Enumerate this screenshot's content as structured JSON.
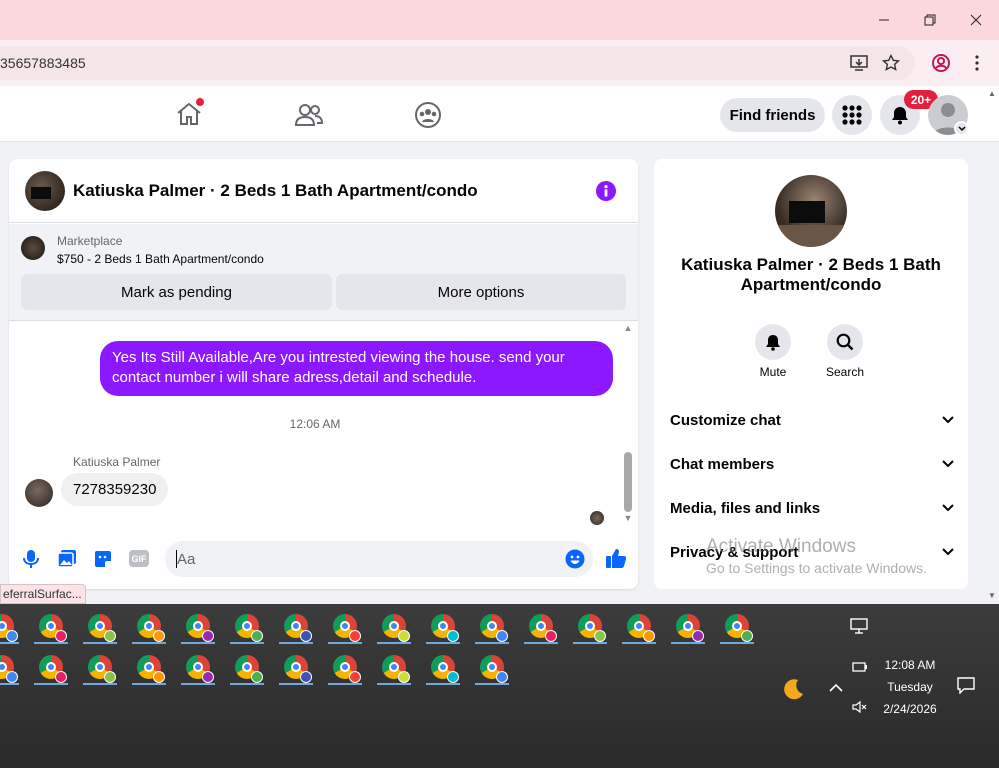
{
  "browser": {
    "address": "35657883485",
    "controls": {
      "minimize": "minimize-icon",
      "restore": "restore-icon",
      "close": "close-icon"
    }
  },
  "fbnav": {
    "find_friends": "Find friends",
    "notification_badge": "20+"
  },
  "chat": {
    "header_title": "Katiuska Palmer · 2 Beds 1 Bath Apartment/condo",
    "listing": {
      "source": "Marketplace",
      "subtitle": "$750 - 2 Beds 1 Bath Apartment/condo",
      "mark_pending": "Mark as pending",
      "more_options": "More options"
    },
    "outgoing_message": "Yes Its Still Available,Are you intrested viewing the house. send your contact number i will share adress,detail and schedule.",
    "timestamp": "12:06 AM",
    "incoming_sender": "Katiuska Palmer",
    "incoming_message": "7278359230",
    "composer_placeholder": "Aa",
    "gif_label": "GIF"
  },
  "side_panel": {
    "name": "Katiuska Palmer · 2 Beds 1 Bath Apartment/condo",
    "mute": "Mute",
    "search": "Search",
    "accordion": [
      "Customize chat",
      "Chat members",
      "Media, files and links",
      "Privacy & support"
    ]
  },
  "watermark": {
    "title": "Activate Windows",
    "subtitle": "Go to Settings to activate Windows."
  },
  "status_tooltip": "eferralSurfac...",
  "taskbar": {
    "time": "12:08 AM",
    "day": "Tuesday",
    "date": "2/24/2026"
  },
  "colors": {
    "messenger_purple": "#8b18ff",
    "facebook_blue": "#0866ff",
    "badge_red": "#e41e3f"
  }
}
